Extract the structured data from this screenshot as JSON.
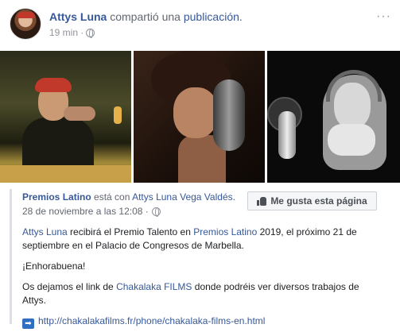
{
  "post": {
    "actor": "Attys Luna",
    "verb": "compartió una",
    "object": "publicación.",
    "time": "19 min ·",
    "more_label": "···"
  },
  "shared": {
    "page": "Premios Latino",
    "with_text": "está con",
    "person": "Attys Luna Vega Valdés.",
    "date": "28 de noviembre a las 12:08 ·",
    "like_button": "Me gusta esta página",
    "body": {
      "p1_link1": "Attys Luna",
      "p1_t1": " recibirá el Premio Talento en ",
      "p1_link2": "Premios Latino",
      "p1_t2": " 2019, el próximo 21 de septiembre en el Palacio de Congresos de Marbella.",
      "p2": "¡Enhorabuena!",
      "p3_t1": "Os dejamos el link de ",
      "p3_link": "Chakalaka FILMS",
      "p3_t2": " donde podréis ver diversos trabajos de Attys.",
      "url": "http://chakalakafilms.fr/phone/chakalaka-films-en.html"
    }
  },
  "colors": {
    "link": "#365899",
    "muted": "#90949c",
    "border": "#dddfe2"
  },
  "icons": {
    "globe": "globe-icon",
    "thumb": "thumbs-up-icon",
    "arrow": "right-arrow-icon"
  }
}
